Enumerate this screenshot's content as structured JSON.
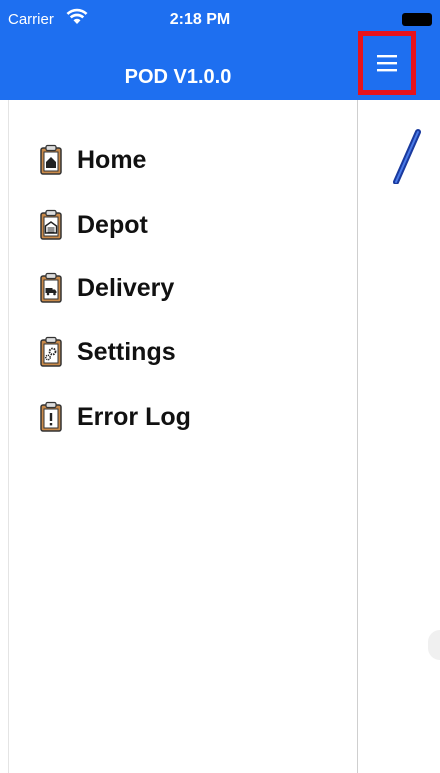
{
  "status_bar": {
    "carrier": "Carrier",
    "time": "2:18 PM"
  },
  "header": {
    "title": "POD V1.0.0"
  },
  "menu_button": {
    "icon": "hamburger-menu-icon",
    "highlight_color": "#e8121b"
  },
  "drawer": {
    "items": [
      {
        "label": "Home",
        "icon": "home-clipboard-icon"
      },
      {
        "label": "Depot",
        "icon": "depot-clipboard-icon"
      },
      {
        "label": "Delivery",
        "icon": "delivery-clipboard-icon"
      },
      {
        "label": "Settings",
        "icon": "settings-clipboard-icon"
      },
      {
        "label": "Error Log",
        "icon": "error-clipboard-icon"
      }
    ]
  },
  "colors": {
    "accent": "#1e6ff0",
    "text": "#111111"
  }
}
